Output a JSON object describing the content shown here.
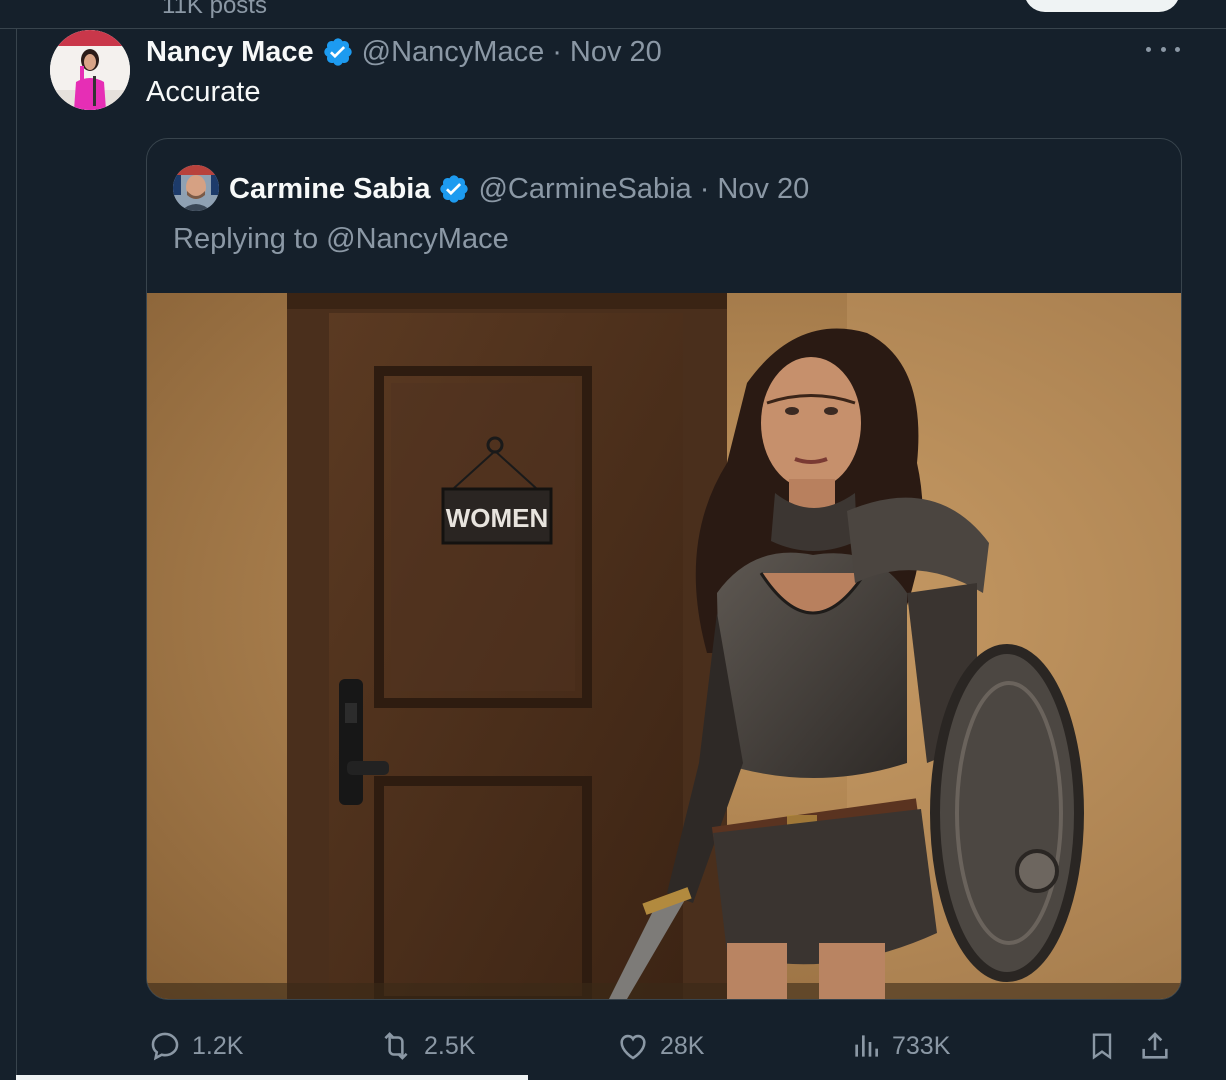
{
  "profile_header": {
    "posts_count": "11K posts"
  },
  "tweet": {
    "author_name": "Nancy Mace",
    "handle": "@NancyMace",
    "separator": "·",
    "date": "Nov 20",
    "text": "Accurate",
    "avatar_icon": "avatar-photo",
    "verified_icon": "verified-badge-icon",
    "more_icon": "more-dots-icon"
  },
  "quoted_tweet": {
    "author_name": "Carmine Sabia",
    "handle": "@CarmineSabia",
    "separator": "·",
    "date": "Nov 20",
    "replying_to": "Replying to @NancyMace",
    "media": {
      "sign_text": "WOMEN"
    }
  },
  "actions": {
    "replies": "1.2K",
    "reposts": "2.5K",
    "likes": "28K",
    "views": "733K"
  },
  "colors": {
    "background": "#15202b",
    "border": "#38444d",
    "secondary_text": "#8b98a5",
    "primary_text": "#f7f9f9",
    "verified_blue": "#1d9bf0"
  }
}
